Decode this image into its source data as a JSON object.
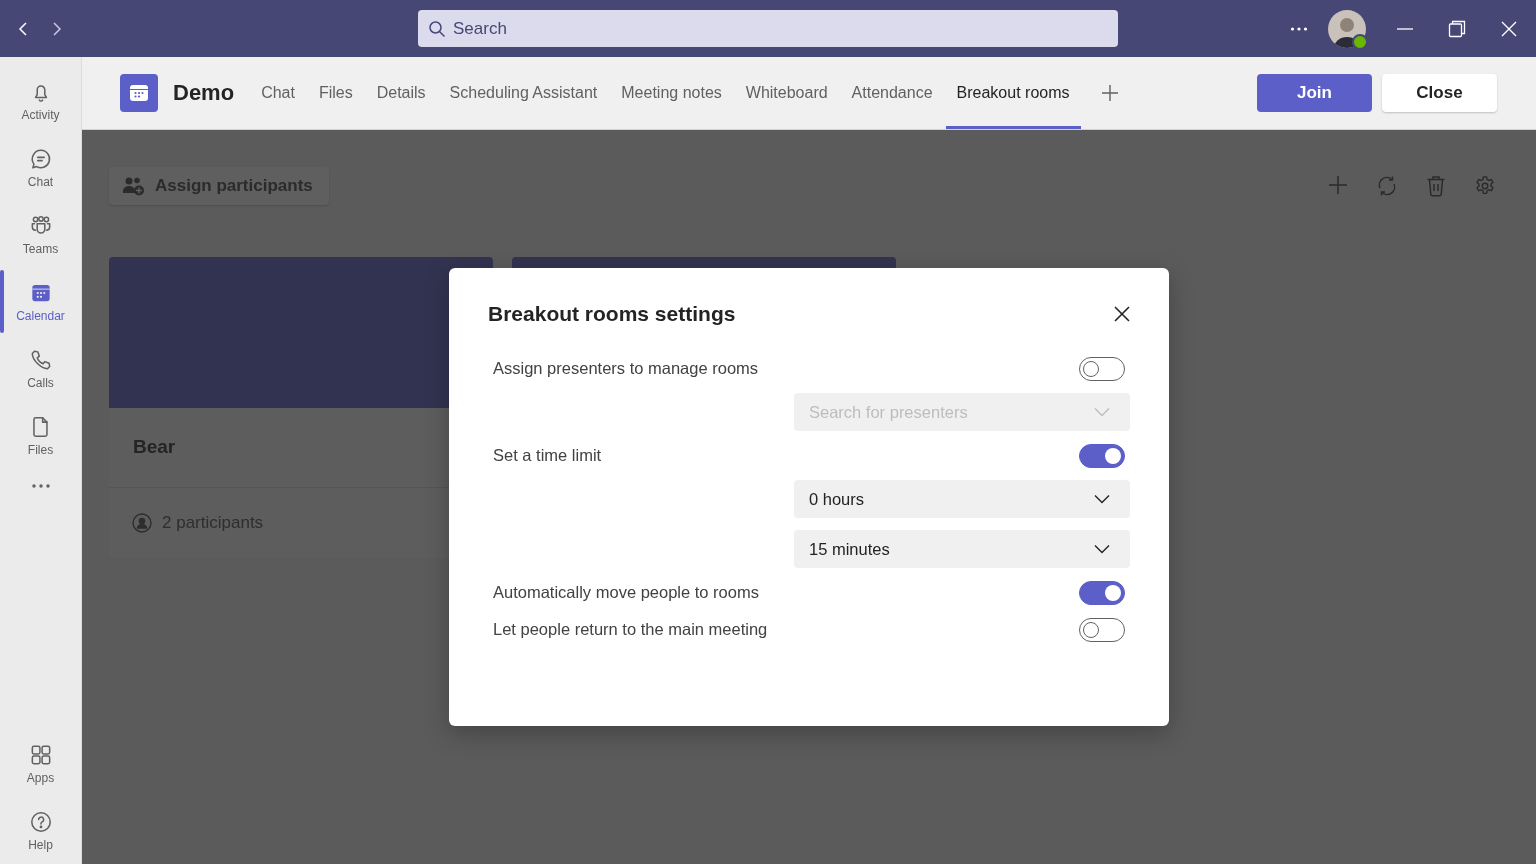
{
  "title_bar": {
    "search": {
      "placeholder": "Search"
    }
  },
  "rail": {
    "items": [
      {
        "kind": "activity",
        "label": "Activity",
        "selected": false
      },
      {
        "kind": "chat",
        "label": "Chat",
        "selected": false
      },
      {
        "kind": "teams",
        "label": "Teams",
        "selected": false
      },
      {
        "kind": "calendar",
        "label": "Calendar",
        "selected": true
      },
      {
        "kind": "calls",
        "label": "Calls",
        "selected": false
      },
      {
        "kind": "files",
        "label": "Files",
        "selected": false
      }
    ],
    "bottom_items": [
      {
        "kind": "apps",
        "label": "Apps",
        "selected": false
      },
      {
        "kind": "help",
        "label": "Help",
        "selected": false
      }
    ]
  },
  "meeting": {
    "title": "Demo",
    "tabs": [
      {
        "label": "Chat",
        "selected": false
      },
      {
        "label": "Files",
        "selected": false
      },
      {
        "label": "Details",
        "selected": false
      },
      {
        "label": "Scheduling Assistant",
        "selected": false
      },
      {
        "label": "Meeting notes",
        "selected": false
      },
      {
        "label": "Whiteboard",
        "selected": false
      },
      {
        "label": "Attendance",
        "selected": false
      },
      {
        "label": "Breakout rooms",
        "selected": true
      }
    ],
    "buttons": [
      {
        "kind": "primary",
        "label": "Join"
      },
      {
        "kind": "secondary",
        "label": "Close"
      }
    ]
  },
  "content": {
    "assign_button": "Assign participants",
    "rooms": [
      {
        "name": "Bear",
        "participants": "2 participants"
      }
    ]
  },
  "dialog": {
    "title": "Breakout rooms settings",
    "settings": [
      {
        "kind": "toggle",
        "label": "Assign presenters to manage rooms",
        "on": false
      },
      {
        "kind": "dropdown",
        "placeholder": "Search for presenters",
        "disabled": true
      },
      {
        "kind": "toggle",
        "label": "Set a time limit",
        "on": true
      },
      {
        "kind": "dropdown",
        "value": "0 hours",
        "disabled": false
      },
      {
        "kind": "dropdown",
        "value": "15 minutes",
        "disabled": false
      },
      {
        "kind": "toggle",
        "label": "Automatically move people to rooms",
        "on": true
      },
      {
        "kind": "toggle",
        "label": "Let people return to the main meeting",
        "on": false
      }
    ]
  }
}
